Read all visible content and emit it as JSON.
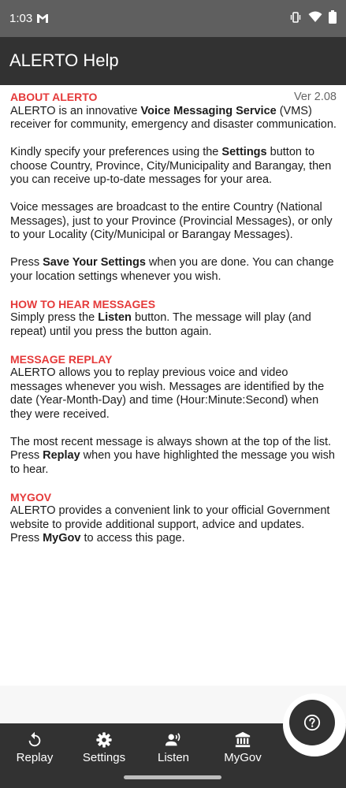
{
  "status": {
    "time": "1:03"
  },
  "app": {
    "title": "ALERTO Help",
    "version": "Ver 2.08"
  },
  "sections": {
    "about": {
      "heading": "ABOUT ALERTO",
      "p1": [
        "ALERTO is an innovative ",
        "Voice Messaging Service",
        " (VMS) receiver for community, emergency and disaster communication."
      ],
      "p2": [
        "Kindly specify your preferences using the ",
        "Settings",
        " button to choose Country, Province, City/Municipality and Barangay, then you can receive up-to-date messages for your area."
      ],
      "p3": "Voice messages are broadcast to the entire Country (National Messages), just to your Province (Provincial Messages), or only to your Locality (City/Municipal or Barangay Messages).",
      "p4": [
        "Press ",
        "Save Your Settings",
        " when you are done.  You can change your location settings whenever you wish."
      ]
    },
    "hear": {
      "heading": "HOW TO HEAR MESSAGES",
      "p1": [
        "Simply press the ",
        "Listen",
        " button. The message will play (and repeat) until you press the button again."
      ]
    },
    "replay": {
      "heading": "MESSAGE REPLAY",
      "p1": "ALERTO allows you to replay previous voice and video messages whenever you wish. Messages are identified by the date (Year-Month-Day) and time (Hour:Minute:Second) when they were received.",
      "p2": [
        "The most recent message is always shown at the top of the list.  Press ",
        "Replay",
        " when you have highlighted the message you wish to hear."
      ]
    },
    "mygov": {
      "heading": "MYGOV",
      "p1": [
        "ALERTO provides a convenient link to your official Government website to provide additional support, advice and updates. Press ",
        "MyGov",
        " to access this page."
      ]
    }
  },
  "nav": {
    "replay": "Replay",
    "settings": "Settings",
    "listen": "Listen",
    "mygov": "MyGov"
  },
  "icons": {
    "replay": "replay-icon",
    "settings": "gear-icon",
    "listen": "speaking-person-icon",
    "mygov": "government-building-icon",
    "help": "help-icon"
  },
  "colors": {
    "heading": "#e53a3a",
    "appbar": "#323232",
    "statusbar": "#5f5f5f"
  }
}
